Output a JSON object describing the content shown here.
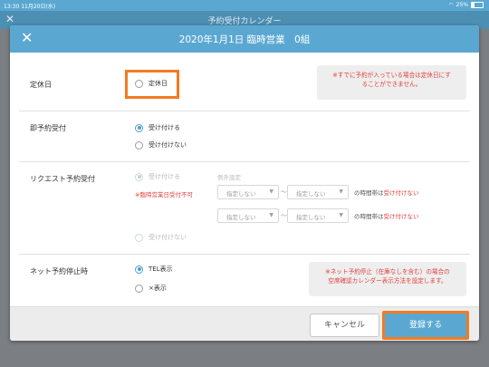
{
  "status_bar": {
    "time_date": "13:30  11月20日(水)",
    "battery": "25%"
  },
  "background": {
    "title": "予約受付カレンダー"
  },
  "modal": {
    "title": "2020年1月1日 臨時営業　0組",
    "holiday": {
      "label": "定休日",
      "option": "定休日",
      "note_line1": "※すでに予約が入っている場合は定休日にす",
      "note_line2": "ることができません。"
    },
    "instant": {
      "label": "即予約受付",
      "options": [
        "受け付ける",
        "受け付けない"
      ],
      "selected": 0
    },
    "request": {
      "label": "リクエスト予約受付",
      "options": [
        "受け付ける",
        "受け付けない"
      ],
      "selected": 0,
      "warning": "※臨時営業日受付不可",
      "exception_label": "例外設定",
      "select_placeholder": "指定しない",
      "tilde": "〜",
      "suffix": "の時間帯は",
      "suffix_red": "受け付けない"
    },
    "net_stop": {
      "label": "ネット予約停止時",
      "options": [
        "TEL表示",
        "×表示"
      ],
      "selected": 0,
      "note_line1": "※ネット予約停止（在庫なしを含む）の場合の",
      "note_line2": "空席確認カレンダー表示方法を設定します。"
    },
    "buttons": {
      "cancel": "キャンセル",
      "submit": "登録する"
    }
  },
  "colors": {
    "header_blue": "#5aa8d2",
    "highlight_orange": "#f27b21",
    "warning_red": "#e0403d"
  }
}
